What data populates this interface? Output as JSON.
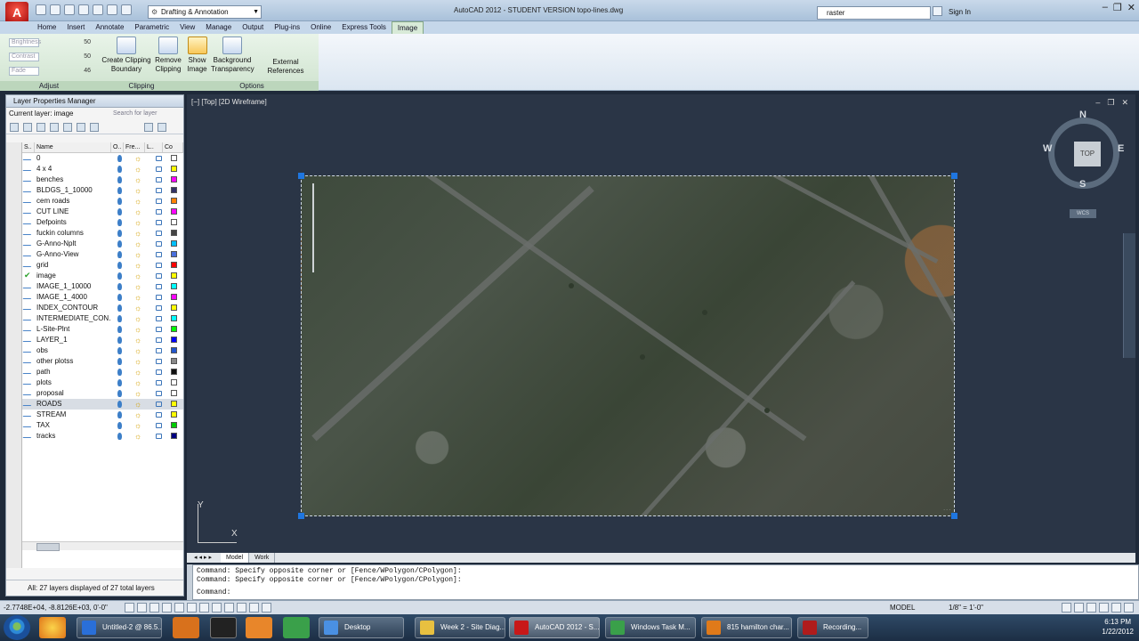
{
  "app": {
    "title": "AutoCAD 2012 - STUDENT VERSION    topo-lines.dwg",
    "logo": "A",
    "workspace": "Drafting & Annotation",
    "search_value": "raster",
    "sign_in": "Sign In"
  },
  "ribbon": {
    "tabs": [
      "Home",
      "Insert",
      "Annotate",
      "Parametric",
      "View",
      "Manage",
      "Output",
      "Plug-ins",
      "Online",
      "Express Tools",
      "Image"
    ],
    "active_tab": "Image",
    "adjust": {
      "sliders": [
        {
          "label": "Brightness",
          "value": "50"
        },
        {
          "label": "Contrast",
          "value": "50"
        },
        {
          "label": "Fade",
          "value": "46"
        }
      ],
      "title": "Adjust"
    },
    "clipping": {
      "create": "Create Clipping Boundary",
      "remove": "Remove Clipping",
      "title": "Clipping"
    },
    "options": {
      "show_image": "Show Image",
      "background": "Background Transparency",
      "external_refs": "External References",
      "title": "Options"
    }
  },
  "layer_manager": {
    "title": "Layer Properties Manager",
    "current_layer": "Current layer: image",
    "search_placeholder": "Search for layer",
    "columns": [
      "S..",
      "Name",
      "O..",
      "Fre...",
      "L..",
      "Co"
    ],
    "layers": [
      {
        "name": "0",
        "color": "#ffffff"
      },
      {
        "name": "4 x 4",
        "color": "#ffff00"
      },
      {
        "name": "benches",
        "color": "#ff00ff"
      },
      {
        "name": "BLDGS_1_10000",
        "color": "#333366"
      },
      {
        "name": "cem roads",
        "color": "#ff8000"
      },
      {
        "name": "CUT LINE",
        "color": "#ff00ff"
      },
      {
        "name": "Defpoints",
        "color": "#ffffff"
      },
      {
        "name": "fuckin columns",
        "color": "#444444"
      },
      {
        "name": "G-Anno-Nplt",
        "color": "#00bfff"
      },
      {
        "name": "G-Anno-View",
        "color": "#4a6fdc"
      },
      {
        "name": "grid",
        "color": "#ff0000"
      },
      {
        "name": "image",
        "color": "#ffff00"
      },
      {
        "name": "IMAGE_1_10000",
        "color": "#00ffff"
      },
      {
        "name": "IMAGE_1_4000",
        "color": "#ff00ff"
      },
      {
        "name": "INDEX_CONTOUR",
        "color": "#ffff00"
      },
      {
        "name": "INTERMEDIATE_CON...",
        "color": "#00ffff"
      },
      {
        "name": "L-Site-Plnt",
        "color": "#00ff00"
      },
      {
        "name": "LAYER_1",
        "color": "#0000ff"
      },
      {
        "name": "obs",
        "color": "#2255cc"
      },
      {
        "name": "other plotss",
        "color": "#888888"
      },
      {
        "name": "path",
        "color": "#111111"
      },
      {
        "name": "plots",
        "color": "#ffffff"
      },
      {
        "name": "proposal",
        "color": "#ffffff"
      },
      {
        "name": "ROADS",
        "color": "#ffff00"
      },
      {
        "name": "STREAM",
        "color": "#ffff00"
      },
      {
        "name": "TAX",
        "color": "#00cc00"
      },
      {
        "name": "tracks",
        "color": "#000080"
      }
    ],
    "current_index": 11,
    "selected_index": 23,
    "status": "All: 27 layers displayed of 27 total layers"
  },
  "viewport": {
    "label": "[−] [Top] [2D Wireframe]",
    "viewcube": {
      "top": "TOP",
      "n": "N",
      "s": "S",
      "e": "E",
      "w": "W",
      "wcs": "WCS"
    },
    "ucs_x": "X",
    "ucs_y": "Y"
  },
  "layout_tabs": [
    "Model",
    "Work"
  ],
  "command": {
    "lines": [
      "Command: Specify opposite corner or [Fence/WPolygon/CPolygon]:",
      "Command: Specify opposite corner or [Fence/WPolygon/CPolygon]:",
      "Command:"
    ]
  },
  "status_bar": {
    "coords": "-2.7748E+04, -8.8126E+03, 0'-0\"",
    "model": "MODEL",
    "scale": "1/8\" = 1'-0\""
  },
  "taskbar": {
    "items": [
      {
        "label": "Untitled-2 @ 86.5...",
        "color": "#2a6fd8"
      },
      {
        "label": "Desktop",
        "color": "#4a90e2"
      },
      {
        "label": "Week 2 - Site Diag...",
        "color": "#e8c040"
      },
      {
        "label": "AutoCAD 2012 - S...",
        "color": "#c81818"
      },
      {
        "label": "Windows Task M...",
        "color": "#3aa04a"
      },
      {
        "label": "815 hamilton char...",
        "color": "#e07a1a"
      },
      {
        "label": "Recording...",
        "color": "#b01c1c"
      }
    ],
    "active_index": 3,
    "time": "6:13 PM",
    "date": "1/22/2012"
  }
}
